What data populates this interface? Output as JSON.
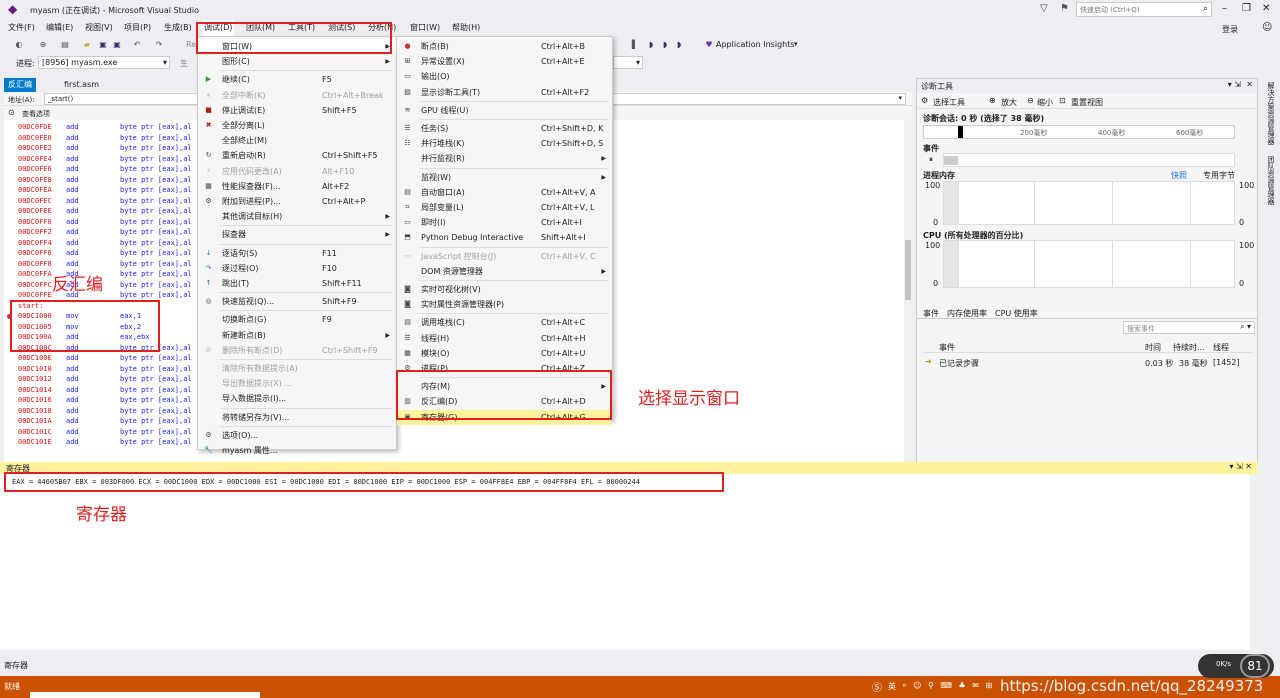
{
  "window": {
    "title": "myasm (正在调试) - Microsoft Visual Studio",
    "quick_launch": "快速启动 (Ctrl+Q)",
    "login": "登录"
  },
  "menubar": {
    "items": [
      "文件(F)",
      "编辑(E)",
      "视图(V)",
      "项目(P)",
      "生成(B)",
      "调试(D)",
      "团队(M)",
      "工具(T)",
      "测试(S)",
      "分析(N)",
      "窗口(W)",
      "帮助(H)"
    ]
  },
  "toolbar": {
    "app_insights": "Application Insights",
    "process_label": "进程:",
    "process_value": "[8956] myasm.exe",
    "re_label": "Re",
    "life_label": "生"
  },
  "tabs": {
    "disasm": "反汇编",
    "first": "first.asm",
    "diag": "诊断工具"
  },
  "disasm": {
    "address_label": "地址(A):",
    "address_value": "_start()",
    "view_options": "查看选项",
    "rows_top": [
      [
        "00DC0FDE",
        "add",
        "byte ptr [eax],al"
      ],
      [
        "00DC0FE0",
        "add",
        "byte ptr [eax],al"
      ],
      [
        "00DC0FE2",
        "add",
        "byte ptr [eax],al"
      ],
      [
        "00DC0FE4",
        "add",
        "byte ptr [eax],al"
      ],
      [
        "00DC0FE6",
        "add",
        "byte ptr [eax],al"
      ],
      [
        "00DC0FE8",
        "add",
        "byte ptr [eax],al"
      ],
      [
        "00DC0FEA",
        "add",
        "byte ptr [eax],al"
      ],
      [
        "00DC0FEC",
        "add",
        "byte ptr [eax],al"
      ],
      [
        "00DC0FEE",
        "add",
        "byte ptr [eax],al"
      ],
      [
        "00DC0FF0",
        "add",
        "byte ptr [eax],al"
      ],
      [
        "00DC0FF2",
        "add",
        "byte ptr [eax],al"
      ],
      [
        "00DC0FF4",
        "add",
        "byte ptr [eax],al"
      ],
      [
        "00DC0FF6",
        "add",
        "byte ptr [eax],al"
      ],
      [
        "00DC0FF8",
        "add",
        "byte ptr [eax],al"
      ],
      [
        "00DC0FFA",
        "add",
        "byte ptr [eax],al"
      ],
      [
        "00DC0FFC",
        "add",
        "byte ptr [eax],al"
      ],
      [
        "00DC0FFE",
        "add",
        "byte ptr [eax],al"
      ]
    ],
    "start_label": "start:",
    "rows_start": [
      [
        "00DC1000",
        "mov",
        "eax,1"
      ],
      [
        "00DC1005",
        "mov",
        "ebx,2"
      ],
      [
        "00DC100A",
        "add",
        "eax,ebx"
      ]
    ],
    "rows_bottom": [
      [
        "00DC100C",
        "add",
        "byte ptr [eax],al"
      ],
      [
        "00DC100E",
        "add",
        "byte ptr [eax],al"
      ],
      [
        "00DC1010",
        "add",
        "byte ptr [eax],al"
      ],
      [
        "00DC1012",
        "add",
        "byte ptr [eax],al"
      ],
      [
        "00DC1014",
        "add",
        "byte ptr [eax],al"
      ],
      [
        "00DC1016",
        "add",
        "byte ptr [eax],al"
      ],
      [
        "00DC1018",
        "add",
        "byte ptr [eax],al"
      ],
      [
        "00DC101A",
        "add",
        "byte ptr [eax],al"
      ],
      [
        "00DC101C",
        "add",
        "byte ptr [eax],al"
      ],
      [
        "00DC101E",
        "add",
        "byte ptr [eax],al"
      ]
    ]
  },
  "debug_menu": [
    {
      "label": "窗口(W)",
      "shortcut": "",
      "arrow": true,
      "highlight": true,
      "icon": ""
    },
    {
      "label": "图形(C)",
      "shortcut": "",
      "arrow": true,
      "icon": ""
    },
    {
      "sep": true
    },
    {
      "label": "继续(C)",
      "shortcut": "F5",
      "icon": "play-icon"
    },
    {
      "label": "全部中断(K)",
      "shortcut": "Ctrl+Alt+Break",
      "disabled": true,
      "icon": "pause-icon"
    },
    {
      "label": "停止调试(E)",
      "shortcut": "Shift+F5",
      "icon": "stop-icon"
    },
    {
      "label": "全部分离(L)",
      "shortcut": "",
      "icon": "detach-icon"
    },
    {
      "label": "全部终止(M)",
      "shortcut": "",
      "icon": ""
    },
    {
      "label": "重新启动(R)",
      "shortcut": "Ctrl+Shift+F5",
      "icon": "restart-icon"
    },
    {
      "label": "应用代码更改(A)",
      "shortcut": "Alt+F10",
      "disabled": true,
      "icon": "apply-icon"
    },
    {
      "label": "性能探查器(F)...",
      "shortcut": "Alt+F2",
      "icon": "profiler-icon"
    },
    {
      "label": "附加到进程(P)...",
      "shortcut": "Ctrl+Alt+P",
      "icon": "attach-icon"
    },
    {
      "label": "其他调试目标(H)",
      "shortcut": "",
      "arrow": true,
      "icon": ""
    },
    {
      "sep": true
    },
    {
      "label": "探查器",
      "shortcut": "",
      "arrow": true,
      "icon": ""
    },
    {
      "sep": true
    },
    {
      "label": "逐语句(S)",
      "shortcut": "F11",
      "icon": "step-into-icon"
    },
    {
      "label": "逐过程(O)",
      "shortcut": "F10",
      "icon": "step-over-icon"
    },
    {
      "label": "跳出(T)",
      "shortcut": "Shift+F11",
      "icon": "step-out-icon"
    },
    {
      "sep": true
    },
    {
      "label": "快速监视(Q)...",
      "shortcut": "Shift+F9",
      "icon": "quickwatch-icon"
    },
    {
      "sep": true
    },
    {
      "label": "切换断点(G)",
      "shortcut": "F9",
      "icon": ""
    },
    {
      "label": "新建断点(B)",
      "shortcut": "",
      "arrow": true,
      "icon": ""
    },
    {
      "label": "删除所有断点(D)",
      "shortcut": "Ctrl+Shift+F9",
      "disabled": true,
      "icon": "delete-breakpoints-icon"
    },
    {
      "sep": true
    },
    {
      "label": "清除所有数据提示(A)",
      "shortcut": "",
      "disabled": true,
      "icon": ""
    },
    {
      "label": "导出数据提示(X) ...",
      "shortcut": "",
      "disabled": true,
      "icon": ""
    },
    {
      "label": "导入数据提示(I)...",
      "shortcut": "",
      "icon": ""
    },
    {
      "sep": true
    },
    {
      "label": "将转储另存为(V)...",
      "shortcut": "",
      "icon": ""
    },
    {
      "sep": true
    },
    {
      "label": "选项(O)...",
      "shortcut": "",
      "icon": "gear-icon"
    },
    {
      "label": "myasm 属性...",
      "shortcut": "",
      "icon": "wrench-icon"
    }
  ],
  "window_menu": [
    {
      "label": "断点(B)",
      "shortcut": "Ctrl+Alt+B",
      "icon": "breakpoint-icon"
    },
    {
      "label": "异常设置(X)",
      "shortcut": "Ctrl+Alt+E",
      "icon": "exception-icon"
    },
    {
      "label": "输出(O)",
      "shortcut": "",
      "icon": "output-icon"
    },
    {
      "label": "显示诊断工具(T)",
      "shortcut": "Ctrl+Alt+F2",
      "icon": "diagnostics-icon"
    },
    {
      "sep": true
    },
    {
      "label": "GPU 线程(U)",
      "shortcut": "",
      "icon": "gpu-icon"
    },
    {
      "sep": true
    },
    {
      "label": "任务(S)",
      "shortcut": "Ctrl+Shift+D, K",
      "icon": "tasks-icon"
    },
    {
      "label": "并行堆栈(K)",
      "shortcut": "Ctrl+Shift+D, S",
      "icon": "parallel-stacks-icon"
    },
    {
      "label": "并行监视(R)",
      "shortcut": "",
      "arrow": true,
      "icon": ""
    },
    {
      "sep": true
    },
    {
      "label": "监视(W)",
      "shortcut": "",
      "arrow": true,
      "icon": ""
    },
    {
      "label": "自动窗口(A)",
      "shortcut": "Ctrl+Alt+V, A",
      "icon": "autos-icon"
    },
    {
      "label": "局部变量(L)",
      "shortcut": "Ctrl+Alt+V, L",
      "icon": "locals-icon"
    },
    {
      "label": "即时(I)",
      "shortcut": "Ctrl+Alt+I",
      "icon": "immediate-icon"
    },
    {
      "label": "Python Debug Interactive",
      "shortcut": "Shift+Alt+I",
      "icon": "python-icon"
    },
    {
      "sep": true
    },
    {
      "label": "JavaScript 控制台(J)",
      "shortcut": "Ctrl+Alt+V, C",
      "disabled": true,
      "icon": "console-icon"
    },
    {
      "label": "DOM 资源管理器",
      "shortcut": "",
      "arrow": true,
      "icon": ""
    },
    {
      "sep": true
    },
    {
      "label": "实时可视化树(V)",
      "shortcut": "",
      "icon": "visual-tree-icon"
    },
    {
      "label": "实时属性资源管理器(P)",
      "shortcut": "",
      "icon": "property-explorer-icon"
    },
    {
      "sep": true
    },
    {
      "label": "调用堆栈(C)",
      "shortcut": "Ctrl+Alt+C",
      "icon": "callstack-icon"
    },
    {
      "label": "线程(H)",
      "shortcut": "Ctrl+Alt+H",
      "icon": "threads-icon"
    },
    {
      "label": "模块(O)",
      "shortcut": "Ctrl+Alt+U",
      "icon": "modules-icon"
    },
    {
      "label": "进程(P)",
      "shortcut": "Ctrl+Alt+Z",
      "icon": "processes-icon"
    },
    {
      "sep": true
    },
    {
      "label": "内存(M)",
      "shortcut": "",
      "arrow": true,
      "icon": ""
    },
    {
      "label": "反汇编(D)",
      "shortcut": "Ctrl+Alt+D",
      "icon": "disassembly-icon"
    },
    {
      "label": "寄存器(G)",
      "shortcut": "Ctrl+Alt+G",
      "highlight": true,
      "icon": "registers-icon"
    }
  ],
  "diag": {
    "select_tools": "选择工具",
    "zoom_in": "放大",
    "zoom_out": "缩小",
    "reset_view": "重置视图",
    "session": "诊断会话: 0 秒 (选择了 38 毫秒)",
    "ticks": [
      "200毫秒",
      "400毫秒",
      "600毫秒"
    ],
    "events": "事件",
    "process_memory": "进程内存",
    "snapshot": "快照",
    "private_bytes": "专用字节",
    "mem_max": "100",
    "mem_min": "0",
    "cpu_title": "CPU (所有处理器的百分比)",
    "cpu_max": "100",
    "cpu_min": "0",
    "tabs": [
      "事件",
      "内存使用率",
      "CPU 使用率"
    ],
    "search_events": "搜索事件",
    "cols": [
      "事件",
      "时间",
      "持续时...",
      "线程"
    ],
    "row": {
      "event": "已记录步骤",
      "time": "0.03 秒",
      "dur": "38 毫秒",
      "thread": "[1452]"
    },
    "side_tab1": "解决方案资源管理器",
    "side_tab2": "团队资源管理器"
  },
  "registers": {
    "title": "寄存器",
    "line": "EAX = 44605B07 EBX = 003DF000 ECX = 00DC1000 EDX = 00DC1000 ESI = 00DC1000 EDI = 00DC1000 EIP = 00DC1000 ESP = 004FF8E4 EBP = 004FF8F4 EFL = 00000244",
    "bottom_tab": "寄存器"
  },
  "annotations": {
    "disasm": "反汇编",
    "select_window": "选择显示窗口",
    "registers": "寄存器"
  },
  "status": {
    "ready": "就绪",
    "watermark": "https://blog.csdn.net/qq_28249373",
    "ime": "英",
    "speed": "0K/s",
    "gauge": "81"
  }
}
